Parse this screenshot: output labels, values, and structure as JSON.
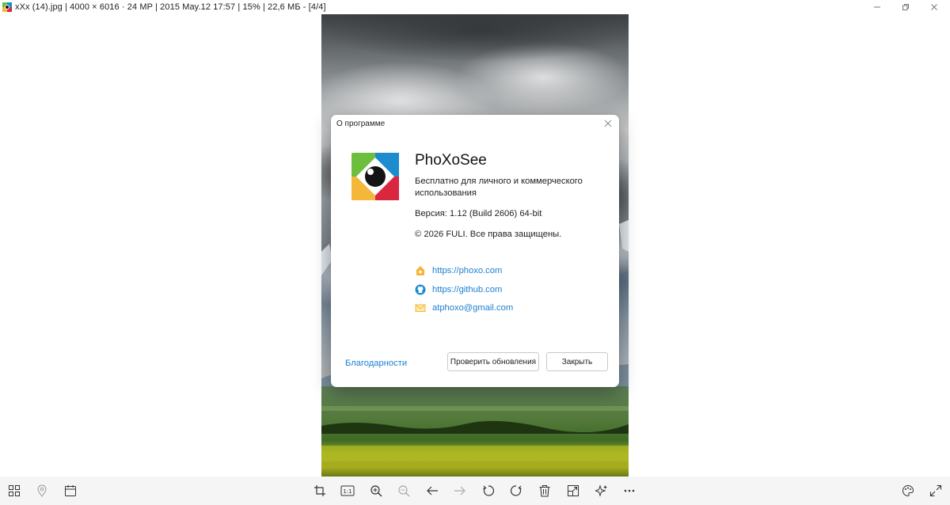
{
  "window": {
    "title": "xXx (14).jpg  |  4000 × 6016  ·  24 MP  |  2015 May.12 17:57  |  15%  |  22,6 МБ  -  [4/4]",
    "minimize_glyph": "—",
    "maximize_glyph": "❐",
    "close_glyph": "✕"
  },
  "dialog": {
    "title": "О программе",
    "app_name": "PhoXoSee",
    "description": "Бесплатно для личного и коммерческого использования",
    "version": "Версия: 1.12 (Build 2606) 64-bit",
    "copyright": "© 2026 FULI. Все права защищены.",
    "links": [
      {
        "icon": "home-icon",
        "text": "https://phoxo.com"
      },
      {
        "icon": "github-icon",
        "text": "https://github.com"
      },
      {
        "icon": "mail-icon",
        "text": "atphoxo@gmail.com"
      }
    ],
    "thanks_label": "Благодарности",
    "check_updates_label": "Проверить обновления",
    "close_label": "Закрыть"
  },
  "toolbar": {
    "zoom_1to1_label": "1:1",
    "left": [
      "grid-icon",
      "location-pin-icon",
      "calendar-icon"
    ],
    "center": [
      "crop-icon",
      "actual-size-icon",
      "zoom-in-icon",
      "zoom-out-icon",
      "arrow-left-icon",
      "arrow-right-icon",
      "rotate-left-icon",
      "rotate-right-icon",
      "delete-icon",
      "resize-icon",
      "enhance-icon",
      "more-icon"
    ],
    "right": [
      "palette-icon",
      "fullscreen-icon"
    ]
  },
  "colors": {
    "link": "#1a7fd0",
    "logo_green": "#6cbf3c",
    "logo_blue": "#1d8ccf",
    "logo_yellow": "#f4b73a",
    "logo_red": "#d9273f"
  }
}
